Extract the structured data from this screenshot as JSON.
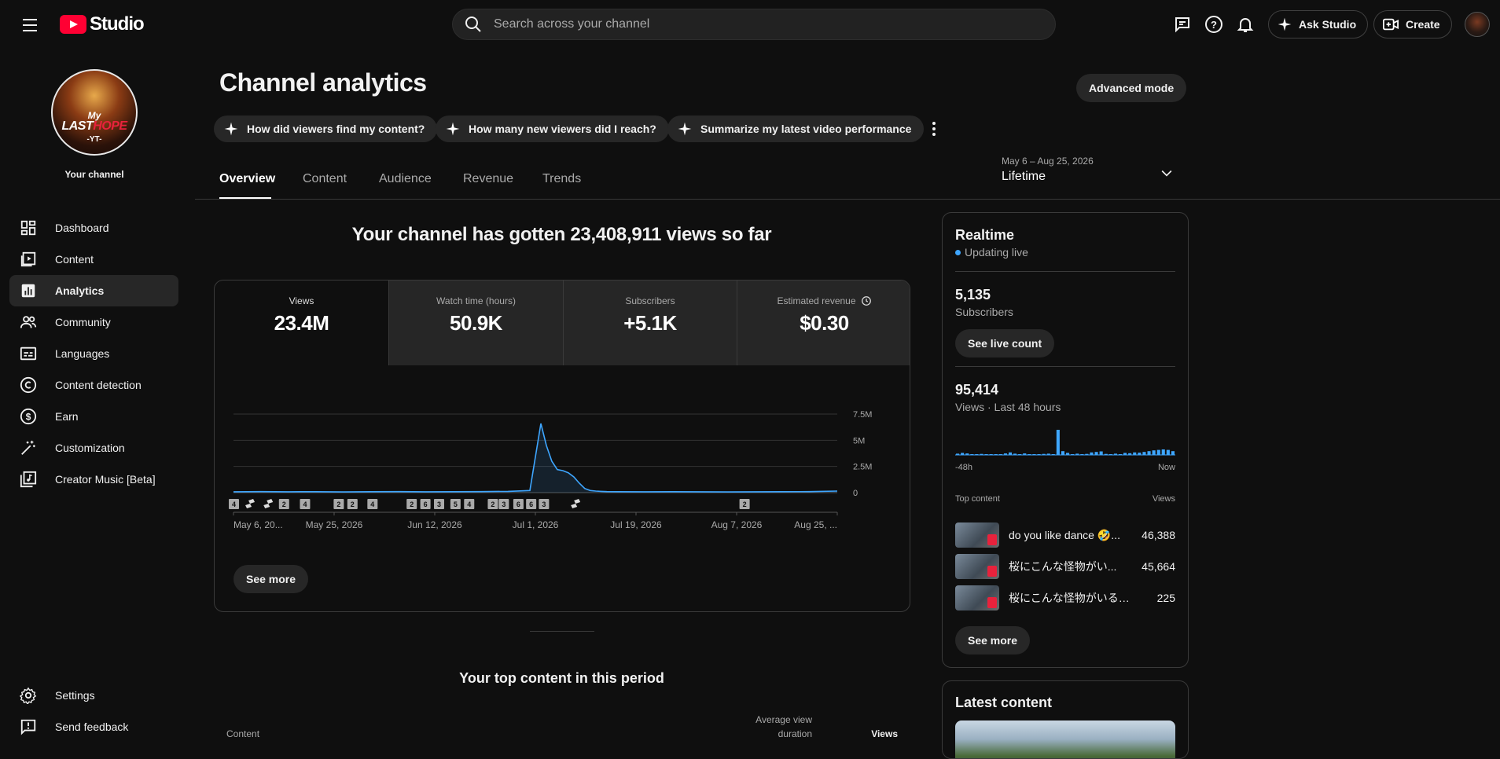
{
  "header": {
    "studio_label": "Studio",
    "search_placeholder": "Search across your channel",
    "ask_studio": "Ask Studio",
    "create": "Create"
  },
  "sidebar": {
    "channel_label": "Your channel",
    "avatar_text": {
      "line1": "My",
      "line2a": "LAST",
      "line2b": "HOPE",
      "line3": "-YT-"
    },
    "items": [
      {
        "label": "Dashboard",
        "icon": "dashboard-icon"
      },
      {
        "label": "Content",
        "icon": "content-icon"
      },
      {
        "label": "Analytics",
        "icon": "analytics-icon",
        "active": true
      },
      {
        "label": "Community",
        "icon": "community-icon"
      },
      {
        "label": "Languages",
        "icon": "languages-icon"
      },
      {
        "label": "Content detection",
        "icon": "copyright-icon"
      },
      {
        "label": "Earn",
        "icon": "dollar-icon"
      },
      {
        "label": "Customization",
        "icon": "magic-wand-icon"
      },
      {
        "label": "Creator Music [Beta]",
        "icon": "music-icon"
      }
    ],
    "bottom": [
      {
        "label": "Settings",
        "icon": "gear-icon"
      },
      {
        "label": "Send feedback",
        "icon": "feedback-icon"
      }
    ]
  },
  "page": {
    "title": "Channel analytics",
    "advanced_mode": "Advanced mode",
    "chips": [
      "How did viewers find my content?",
      "How many new viewers did I reach?",
      "Summarize my latest video performance"
    ],
    "tabs": [
      "Overview",
      "Content",
      "Audience",
      "Revenue",
      "Trends"
    ],
    "date_range": {
      "sub": "May 6 – Aug 25, 2026",
      "value": "Lifetime"
    },
    "headline": "Your channel has gotten 23,408,911 views so far"
  },
  "metrics": [
    {
      "label": "Views",
      "value": "23.4M"
    },
    {
      "label": "Watch time (hours)",
      "value": "50.9K"
    },
    {
      "label": "Subscribers",
      "value": "+5.1K"
    },
    {
      "label": "Estimated revenue",
      "value": "$0.30"
    }
  ],
  "chart_data": {
    "type": "line",
    "title": "",
    "xlabel": "",
    "ylabel": "",
    "y_ticks": [
      "7.5M",
      "5M",
      "2.5M",
      "0"
    ],
    "ylim": [
      0,
      7500000
    ],
    "x_ticks": [
      "May 6, 20...",
      "May 25, 2026",
      "Jun 12, 2026",
      "Jul 1, 2026",
      "Jul 19, 2026",
      "Aug 7, 2026",
      "Aug 25, ..."
    ],
    "series": [
      {
        "x": [
          0,
          5,
          10,
          15,
          20,
          25,
          30,
          35,
          40,
          45,
          50,
          54,
          56,
          57,
          58,
          59,
          60,
          61,
          62,
          63,
          64,
          65,
          66,
          67,
          68,
          70,
          75,
          80,
          85,
          90,
          95,
          100,
          105,
          110
        ],
        "values": [
          80000,
          100000,
          80000,
          90000,
          70000,
          90000,
          100000,
          80000,
          90000,
          100000,
          120000,
          200000,
          6600000,
          4500000,
          3000000,
          2200000,
          2100000,
          1900000,
          1500000,
          900000,
          400000,
          200000,
          150000,
          120000,
          100000,
          90000,
          80000,
          90000,
          80000,
          70000,
          80000,
          90000,
          100000,
          150000
        ]
      }
    ],
    "markers": [
      "4",
      "shorts",
      "shorts",
      "2",
      "4",
      "2",
      "2",
      "4",
      "2",
      "6",
      "3",
      "5",
      "4",
      "2",
      "3",
      "6",
      "6",
      "3",
      "shorts",
      "2"
    ],
    "grid": true,
    "color": "#3ea6ff"
  },
  "see_more": "See more",
  "realtime": {
    "title": "Realtime",
    "status": "Updating live",
    "subscribers_value": "5,135",
    "subscribers_label": "Subscribers",
    "see_live_count": "See live count",
    "views_value": "95,414",
    "views_label": "Views · Last 48 hours",
    "axis_left": "-48h",
    "axis_right": "Now",
    "bars": [
      0.05,
      0.08,
      0.06,
      0.02,
      0.0,
      0.04,
      0.02,
      0.02,
      0.0,
      0.0,
      0.06,
      0.1,
      0.05,
      0.03,
      0.06,
      0.02,
      0.03,
      0.0,
      0.04,
      0.05,
      0.03,
      1.0,
      0.15,
      0.08,
      0.02,
      0.05,
      0.03,
      0.04,
      0.1,
      0.12,
      0.14,
      0.04,
      0.02,
      0.05,
      0.03,
      0.08,
      0.07,
      0.1,
      0.09,
      0.12,
      0.15,
      0.18,
      0.2,
      0.22,
      0.2,
      0.15
    ],
    "top_content_label": "Top content",
    "views_col": "Views",
    "rows": [
      {
        "title": "do you like dance 🤣...",
        "views": "46,388"
      },
      {
        "title": "桜にこんな怪物がい...",
        "views": "45,664"
      },
      {
        "title": "桜にこんな怪物がいると...",
        "views": "225"
      }
    ],
    "see_more": "See more"
  },
  "latest": {
    "title": "Latest content"
  },
  "top_content": {
    "title": "Your top content in this period",
    "col_content": "Content",
    "col_avd_1": "Average view",
    "col_avd_2": "duration",
    "col_views": "Views"
  }
}
